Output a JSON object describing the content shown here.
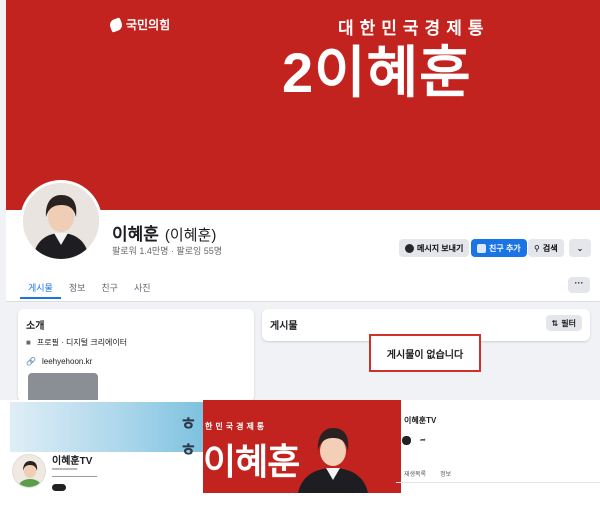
{
  "cover": {
    "party_name": "국민의힘",
    "slogan": "대한민국경제통",
    "headline": "2이혜훈"
  },
  "profile": {
    "name": "이혜훈",
    "alt_name": "(이혜훈)",
    "stats": "팔로워 1.4만명 · 팔로잉 55명"
  },
  "actions": {
    "message": "메시지 보내기",
    "add_friend": "친구 추가",
    "search": "검색"
  },
  "tabs": [
    "게시물",
    "정보",
    "친구",
    "사진"
  ],
  "more_label": "···",
  "intro": {
    "title": "소개",
    "category": "프로필 · 디지털 크리에이터",
    "website": "leehyehoon.kr"
  },
  "posts": {
    "title": "게시물",
    "filter": "필터",
    "empty_message": "게시물이 없습니다"
  },
  "youtube": {
    "banner_text": "ㅎㅎ",
    "channel_name": "이혜훈TV",
    "red_slogan": "한민국경제통",
    "red_name": "이혜훈",
    "right_title": "이혜훈TV",
    "faint_text": "",
    "tabs": [
      "재생목록",
      "정보"
    ]
  },
  "colors": {
    "party_red": "#c3231f",
    "fb_blue": "#1b74e4",
    "highlight_border": "#d0312d"
  }
}
